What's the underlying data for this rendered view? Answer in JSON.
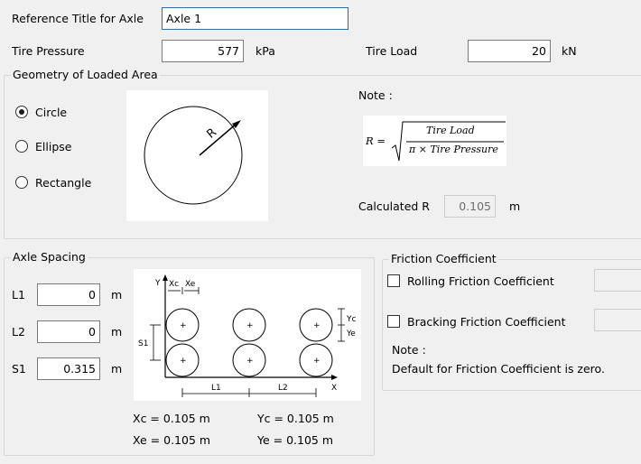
{
  "axle": {
    "ref_title_label": "Reference Title for Axle",
    "ref_title_value": "Axle 1",
    "tire_pressure_label": "Tire Pressure",
    "tire_pressure_value": "577",
    "tire_pressure_unit": "kPa",
    "tire_load_label": "Tire Load",
    "tire_load_value": "20",
    "tire_load_unit": "kN"
  },
  "geometry": {
    "title": "Geometry of Loaded Area",
    "options": [
      "Circle",
      "Ellipse",
      "Rectangle"
    ],
    "selected": "Circle",
    "diagram_label": "R",
    "note_label": "Note :",
    "formula_lhs": "R =",
    "formula_num": "Tire Load",
    "formula_den": "π × Tire Pressure",
    "calc_label": "Calculated R",
    "calc_value": "0.105",
    "calc_unit": "m"
  },
  "spacing": {
    "title": "Axle Spacing",
    "l1_label": "L1",
    "l1_value": "0",
    "l1_unit": "m",
    "l2_label": "L2",
    "l2_value": "0",
    "l2_unit": "m",
    "s1_label": "S1",
    "s1_value": "0.315",
    "s1_unit": "m",
    "diagram": {
      "y": "Y",
      "x": "X",
      "xc": "Xc",
      "xe": "Xe",
      "yc": "Yc",
      "ye": "Ye",
      "s1": "S1",
      "l1": "L1",
      "l2": "L2",
      "plus": "+"
    },
    "xc_text": "Xc = 0.105 m",
    "yc_text": "Yc = 0.105 m",
    "xe_text": "Xe = 0.105 m",
    "ye_text": "Ye = 0.105 m"
  },
  "friction": {
    "title": "Friction Coefficient",
    "rolling_label": "Rolling Friction Coefficient",
    "bracking_label": "Bracking Friction Coefficient",
    "note_label": "Note :",
    "note_text": "Default for Friction Coefficient is zero."
  }
}
